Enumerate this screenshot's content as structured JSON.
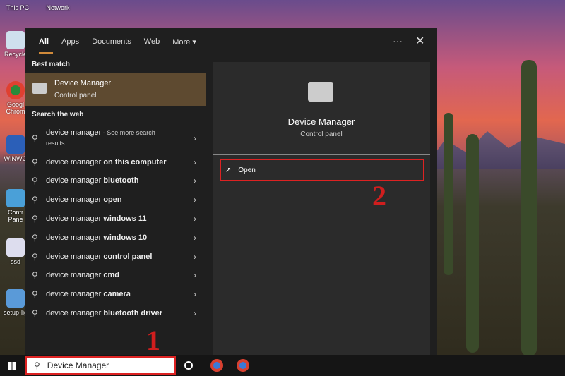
{
  "desktop": {
    "icons": [
      "This PC",
      "Network",
      "Recycle",
      "Googl Chrom",
      "WINWO",
      "Contr Pane",
      "ssd",
      "setup-lig"
    ]
  },
  "tabs": [
    "All",
    "Apps",
    "Documents",
    "Web",
    "More"
  ],
  "sections": {
    "best_match": "Best match",
    "search_web": "Search the web"
  },
  "best": {
    "title": "Device Manager",
    "subtitle": "Control panel"
  },
  "web_first": {
    "query": "device manager",
    "suffix": " - See more search",
    "suffix2": "results"
  },
  "suggestions": [
    {
      "pre": "device manager ",
      "bold": "on this computer"
    },
    {
      "pre": "device manager ",
      "bold": "bluetooth"
    },
    {
      "pre": "device manager ",
      "bold": "open"
    },
    {
      "pre": "device manager ",
      "bold": "windows 11"
    },
    {
      "pre": "device manager ",
      "bold": "windows 10"
    },
    {
      "pre": "device manager ",
      "bold": "control panel"
    },
    {
      "pre": "device manager ",
      "bold": "cmd"
    },
    {
      "pre": "device manager ",
      "bold": "camera"
    },
    {
      "pre": "device manager ",
      "bold": "bluetooth driver"
    }
  ],
  "detail": {
    "title": "Device Manager",
    "subtitle": "Control panel",
    "open": "Open"
  },
  "taskbar": {
    "search_value": "Device Manager"
  },
  "annotations": {
    "one": "1",
    "two": "2"
  }
}
